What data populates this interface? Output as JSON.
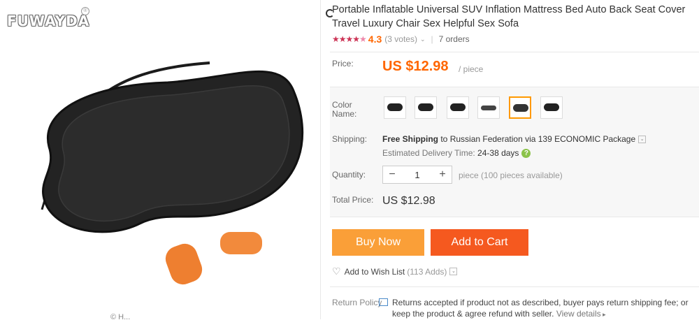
{
  "brand": {
    "logo_text": "FUWAYDA",
    "logo_mark": "®"
  },
  "gallery": {
    "bottom_caption": "© H..."
  },
  "product": {
    "title": "Portable Inflatable Universal SUV Inflation Mattress Bed Auto Back Seat Cover Travel Luxury Chair Sex Helpful Sex Sofa",
    "rating": "4.3",
    "votes": "(3 votes)",
    "orders": "7 orders"
  },
  "price": {
    "label": "Price:",
    "value": "US $12.98",
    "unit": "/ piece"
  },
  "color": {
    "label": "Color Name:",
    "swatches": [
      {
        "name": "variant-1",
        "selected": false
      },
      {
        "name": "variant-2",
        "selected": false
      },
      {
        "name": "variant-3",
        "selected": false
      },
      {
        "name": "variant-4",
        "selected": false
      },
      {
        "name": "variant-5",
        "selected": true
      },
      {
        "name": "variant-6",
        "selected": false
      }
    ]
  },
  "shipping": {
    "label": "Shipping:",
    "free": "Free Shipping",
    "to_text": " to Russian Federation via 139 ECONOMIC Package",
    "est_label": "Estimated Delivery Time: ",
    "est_days": "24-38  days"
  },
  "quantity": {
    "label": "Quantity:",
    "value": "1",
    "minus": "−",
    "plus": "+",
    "note": "piece (100 pieces available)"
  },
  "total": {
    "label": "Total Price:",
    "value": "US $12.98"
  },
  "actions": {
    "buy_now": "Buy Now",
    "add_to_cart": "Add to Cart"
  },
  "wishlist": {
    "label": "Add to Wish List",
    "count": "(113 Adds)"
  },
  "return_policy": {
    "label": "Return Policy",
    "text": "Returns accepted if product not as described, buyer pays return shipping fee; or keep the product & agree refund with seller.",
    "link": "View details"
  },
  "colors": {
    "price": "#ff6600",
    "buy_now": "#fa9f38",
    "add_to_cart": "#f5591f",
    "selected_swatch": "#ff9900"
  }
}
